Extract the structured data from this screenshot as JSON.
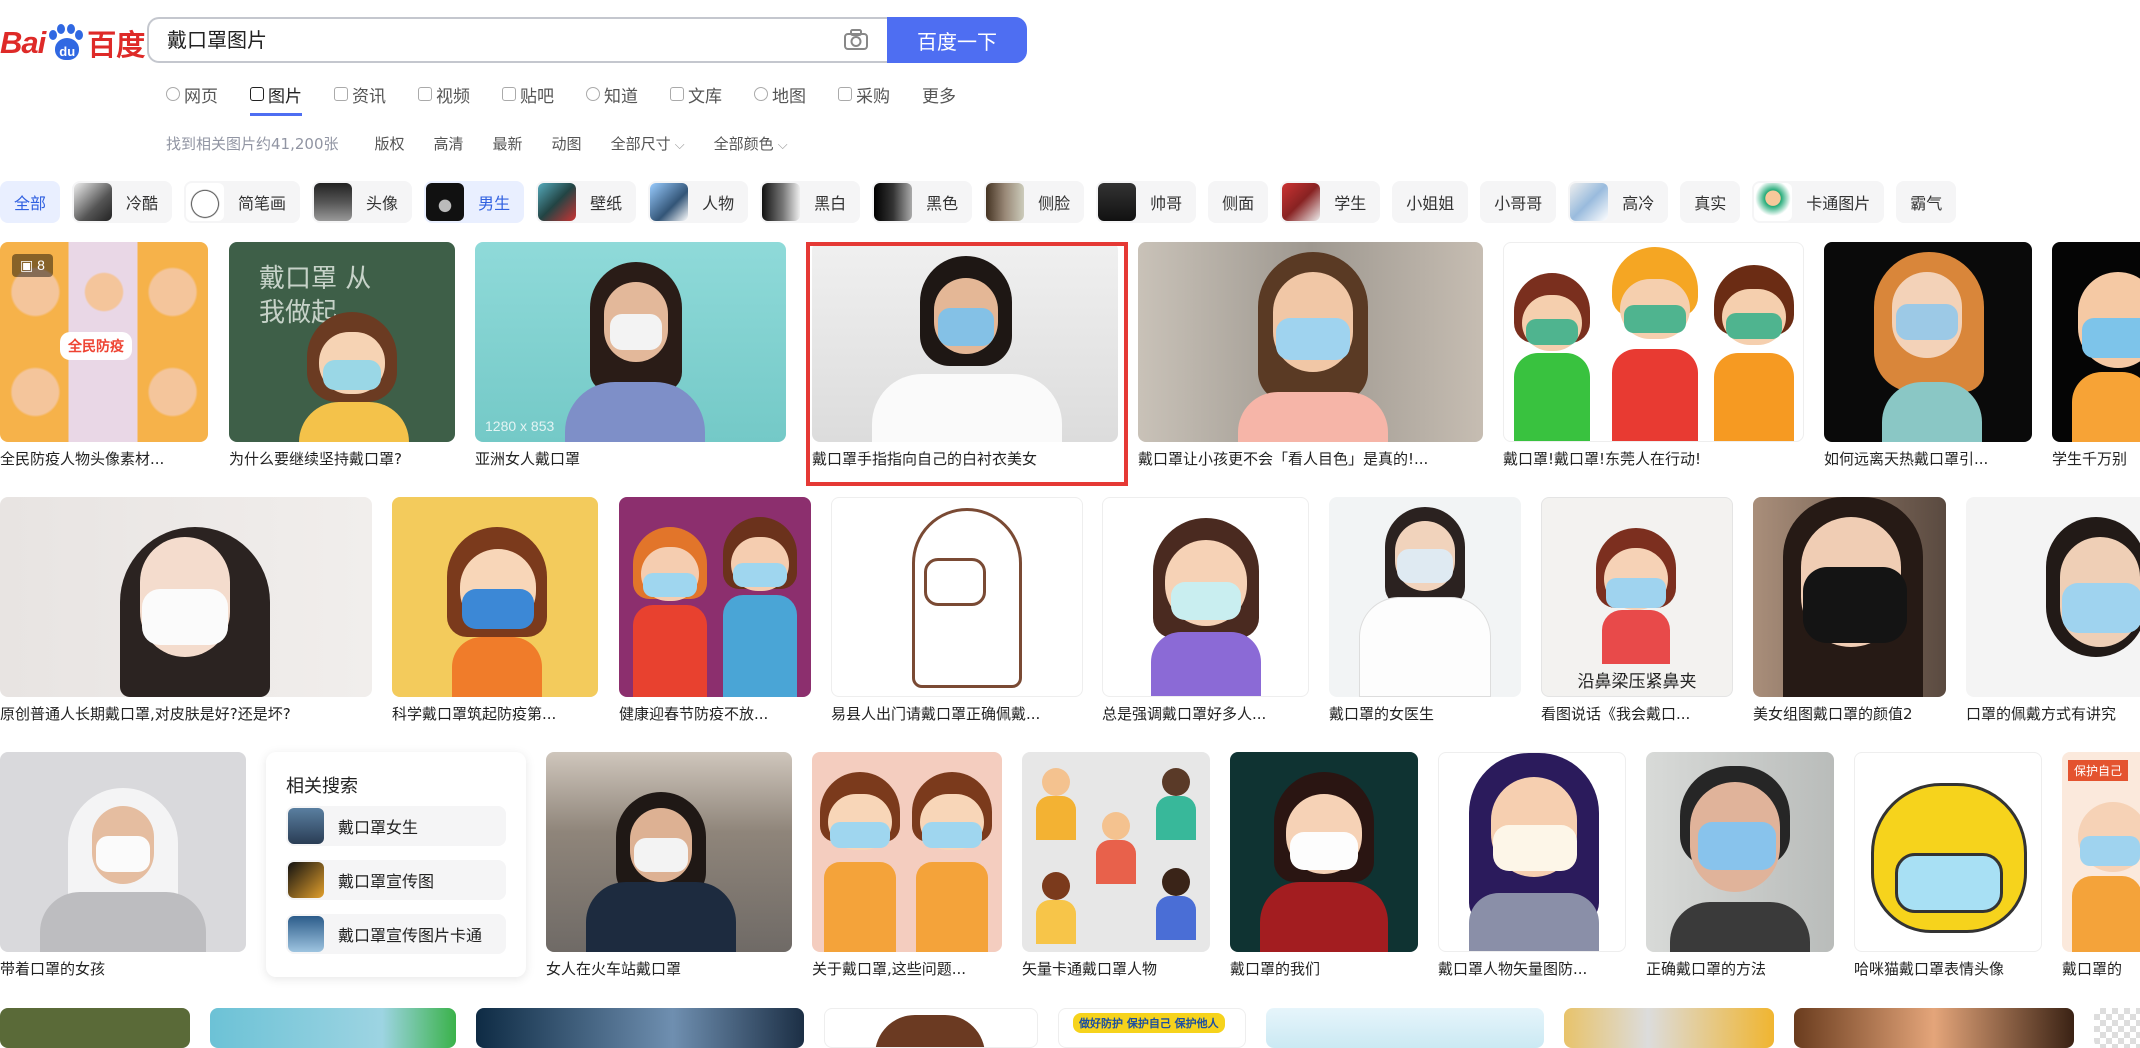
{
  "logo": {
    "latin": "Bai",
    "paw": "du",
    "cn": "百度"
  },
  "search": {
    "value": "戴口罩图片",
    "button": "百度一下",
    "camera_icon": "camera-icon"
  },
  "tabs": [
    {
      "label": "网页",
      "icon": "search-icon"
    },
    {
      "label": "图片",
      "icon": "image-icon"
    },
    {
      "label": "资讯",
      "icon": "news-icon"
    },
    {
      "label": "视频",
      "icon": "video-icon"
    },
    {
      "label": "贴吧",
      "icon": "tieba-icon"
    },
    {
      "label": "知道",
      "icon": "question-icon"
    },
    {
      "label": "文库",
      "icon": "doc-icon"
    },
    {
      "label": "地图",
      "icon": "map-icon"
    },
    {
      "label": "采购",
      "icon": "cart-icon"
    },
    {
      "label": "更多"
    }
  ],
  "filters": {
    "count": "找到相关图片约41,200张",
    "items": [
      "版权",
      "高清",
      "最新",
      "动图",
      "全部尺寸",
      "全部颜色"
    ]
  },
  "chips": [
    "全部",
    "冷酷",
    "简笔画",
    "头像",
    "男生",
    "壁纸",
    "人物",
    "黑白",
    "黑色",
    "侧脸",
    "帅哥",
    "侧面",
    "学生",
    "小姐姐",
    "小哥哥",
    "高冷",
    "真实",
    "卡通图片",
    "霸气"
  ],
  "row1": [
    {
      "caption": "全民防疫人物头像素材...",
      "badge": "8",
      "inner": "全民防疫"
    },
    {
      "caption": "为什么要继续坚持戴口罩?",
      "inner": "戴口罩 从我做起"
    },
    {
      "caption": "亚洲女人戴口罩",
      "size": "1280 x 853"
    },
    {
      "caption": "戴口罩手指指向自己的白衬衣美女"
    },
    {
      "caption": "戴口罩让小孩更不会「看人目色」是真的!..."
    },
    {
      "caption": "戴口罩!戴口罩!东莞人在行动!"
    },
    {
      "caption": "如何远离天热戴口罩引..."
    },
    {
      "caption": "学生千万别"
    }
  ],
  "row2": [
    {
      "caption": "原创普通人长期戴口罩,对皮肤是好?还是坏?"
    },
    {
      "caption": "科学戴口罩筑起防疫第..."
    },
    {
      "caption": "健康迎春节防疫不放..."
    },
    {
      "caption": "易县人出门请戴口罩正确佩戴..."
    },
    {
      "caption": "总是强调戴口罩好多人..."
    },
    {
      "caption": "戴口罩的女医生"
    },
    {
      "caption": "看图说话《我会戴口...",
      "inner": "沿鼻梁压紧鼻夹"
    },
    {
      "caption": "美女组图戴口罩的颜值2"
    },
    {
      "caption": "口罩的佩戴方式有讲究"
    }
  ],
  "row3": [
    {
      "caption": "带着口罩的女孩"
    },
    {
      "caption": "女人在火车站戴口罩"
    },
    {
      "caption": "关于戴口罩,这些问题..."
    },
    {
      "caption": "矢量卡通戴口罩人物"
    },
    {
      "caption": "戴口罩的我们"
    },
    {
      "caption": "戴口罩人物矢量图防..."
    },
    {
      "caption": "正确戴口罩的方法"
    },
    {
      "caption": "哈咪猫戴口罩表情头像"
    },
    {
      "caption": "戴口罩的",
      "inner": "保护自己"
    }
  ],
  "row4": {
    "banner": "做好防护 保护自己 保护他人"
  },
  "related": {
    "title": "相关搜索",
    "items": [
      "戴口罩女生",
      "戴口罩宣传图",
      "戴口罩宣传图片卡通"
    ]
  }
}
